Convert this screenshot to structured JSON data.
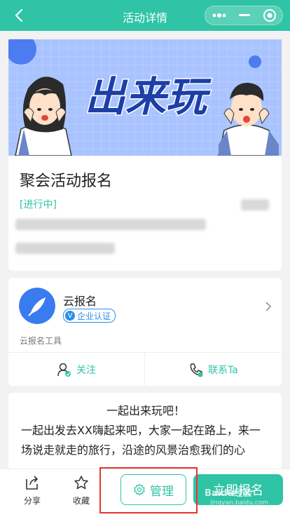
{
  "navbar": {
    "title": "活动详情"
  },
  "event": {
    "banner_text": "出来玩",
    "title": "聚会活动报名",
    "status": "[进行中]"
  },
  "organizer": {
    "name": "云报名",
    "verify_label": "企业认证",
    "verify_glyph": "V",
    "subtitle": "云报名工具",
    "follow_label": "关注",
    "contact_label": "联系Ta"
  },
  "description": {
    "heading": "一起出来玩吧！",
    "body": "一起出发去XX嗨起来吧，大家一起在路上，来一场说走就走的旅行，沿途的风景治愈我们的心"
  },
  "bottom_bar": {
    "share_label": "分享",
    "favorite_label": "收藏",
    "manage_label": "管理",
    "signup_label": "立即报名"
  },
  "watermark": {
    "text": "Baidu经验",
    "sub": "jingyan.baidu.com"
  },
  "colors": {
    "accent": "#2ec4a5",
    "verify": "#2a8fe8",
    "highlight": "#e53333",
    "banner_bg": "#a9c3ff"
  }
}
